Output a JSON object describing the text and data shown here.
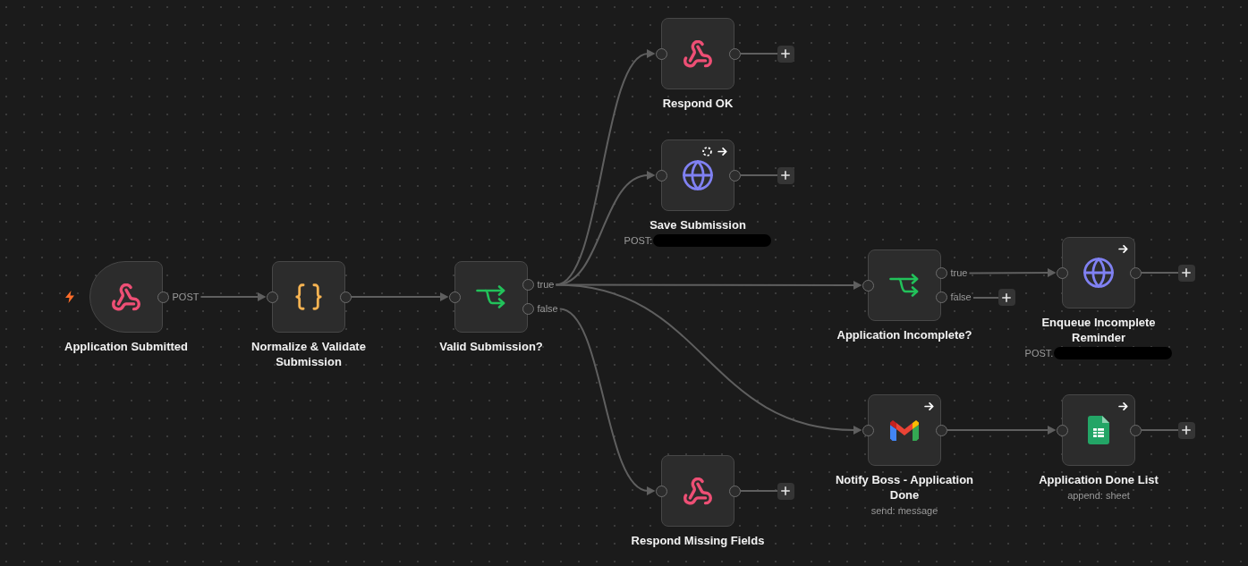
{
  "canvas": {
    "nodes": [
      {
        "kind": "webhook",
        "trigger": true,
        "title": "Application Submitted",
        "redacted": false,
        "retry_on_fail": false,
        "always_output_data": false,
        "outputs": [
          {
            "label": "POST",
            "add_button": false
          }
        ]
      },
      {
        "kind": "code",
        "trigger": false,
        "title": "Normalize & Validate Submission",
        "redacted": false,
        "retry_on_fail": false,
        "always_output_data": false,
        "outputs": [
          {
            "add_button": false
          }
        ]
      },
      {
        "kind": "if",
        "trigger": false,
        "title": "Valid Submission?",
        "redacted": false,
        "retry_on_fail": false,
        "always_output_data": false,
        "outputs": [
          {
            "label": "true",
            "add_button": false
          },
          {
            "label": "false",
            "add_button": false
          }
        ]
      },
      {
        "kind": "webhook",
        "trigger": false,
        "title": "Respond OK",
        "redacted": false,
        "retry_on_fail": false,
        "always_output_data": false,
        "outputs": [
          {
            "add_button": true
          }
        ]
      },
      {
        "kind": "http",
        "trigger": false,
        "title": "Save Submission",
        "subtitle": "POST:",
        "redacted": true,
        "retry_on_fail": true,
        "always_output_data": true,
        "outputs": [
          {
            "add_button": true
          }
        ]
      },
      {
        "kind": "if",
        "trigger": false,
        "title": "Application Incomplete?",
        "redacted": false,
        "retry_on_fail": false,
        "always_output_data": false,
        "outputs": [
          {
            "label": "true",
            "add_button": false
          },
          {
            "label": "false",
            "add_button": true
          }
        ]
      },
      {
        "kind": "http",
        "trigger": false,
        "title": "Enqueue Incomplete Reminder",
        "subtitle": "POST.",
        "redacted": true,
        "retry_on_fail": false,
        "always_output_data": true,
        "outputs": [
          {
            "add_button": true
          }
        ]
      },
      {
        "kind": "gmail",
        "trigger": false,
        "title": "Notify Boss - Application Done",
        "subtitle": "send: message",
        "redacted": false,
        "retry_on_fail": false,
        "always_output_data": true,
        "outputs": [
          {
            "add_button": false
          }
        ]
      },
      {
        "kind": "sheets",
        "trigger": false,
        "title": "Application Done List",
        "subtitle": "append: sheet",
        "redacted": false,
        "retry_on_fail": false,
        "always_output_data": true,
        "outputs": [
          {
            "add_button": true
          }
        ]
      },
      {
        "kind": "webhook",
        "trigger": false,
        "title": "Respond Missing Fields",
        "redacted": false,
        "retry_on_fail": false,
        "always_output_data": false,
        "outputs": [
          {
            "add_button": true
          }
        ]
      }
    ]
  }
}
